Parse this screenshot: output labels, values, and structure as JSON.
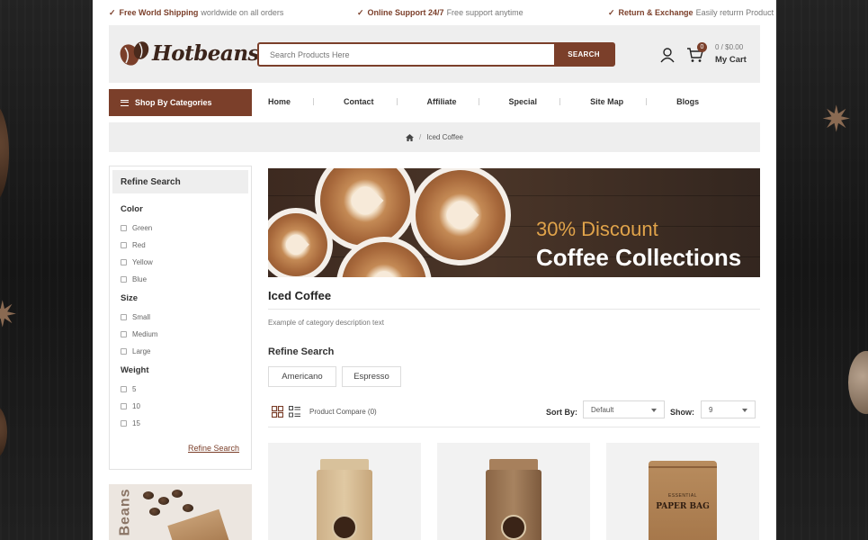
{
  "topbar": {
    "shipping_strong": "Free World Shipping",
    "shipping_rest": "worldwide on all orders",
    "support_strong": "Online Support 24/7",
    "support_rest": "Free support anytime",
    "return_strong": "Return & Exchange",
    "return_rest": "Easily returrn Product"
  },
  "header": {
    "logo_text": "Hotbeans",
    "search_placeholder": "Search Products Here",
    "search_button": "SEARCH",
    "cart_count": "0",
    "cart_total": "0 / $0.00",
    "cart_label": "My Cart"
  },
  "nav": {
    "categories_label": "Shop By Categories",
    "items": [
      "Home",
      "Contact",
      "Affiliate",
      "Special",
      "Site Map",
      "Blogs"
    ]
  },
  "breadcrumb": {
    "current": "Iced Coffee"
  },
  "sidebar": {
    "title": "Refine Search",
    "groups": [
      {
        "name": "Color",
        "options": [
          "Green",
          "Red",
          "Yellow",
          "Blue"
        ]
      },
      {
        "name": "Size",
        "options": [
          "Small",
          "Medium",
          "Large"
        ]
      },
      {
        "name": "Weight",
        "options": [
          "5",
          "10",
          "15"
        ]
      }
    ],
    "refine_link": "Refine Search",
    "promo_word": "Beans"
  },
  "banner": {
    "discount": "30% Discount",
    "title": "Coffee Collections"
  },
  "category": {
    "title": "Iced Coffee",
    "description": "Example of category description text",
    "refine_title": "Refine Search",
    "refine_options": [
      "Americano",
      "Espresso"
    ]
  },
  "toolbar": {
    "compare": "Product Compare (0)",
    "sort_label": "Sort By:",
    "sort_value": "Default",
    "show_label": "Show:",
    "show_value": "9"
  },
  "products": {
    "bag3_text_small": "ESSENTIAL",
    "bag3_text": "PAPER BAG"
  },
  "colors": {
    "accent": "#7b3f2a",
    "panel": "#eeeeee",
    "discount": "#e0a34a"
  }
}
